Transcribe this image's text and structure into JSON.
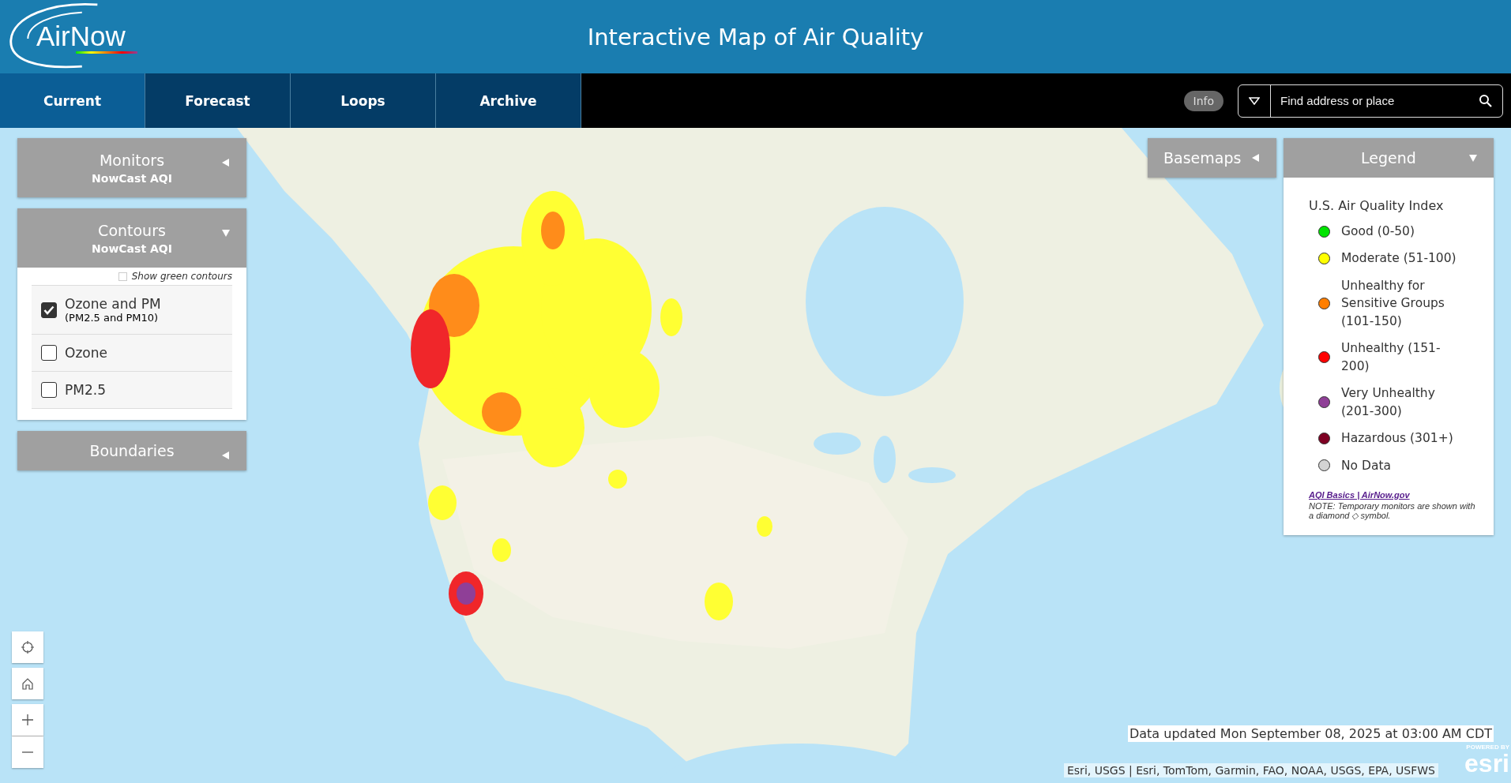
{
  "header": {
    "logo": "AirNow",
    "title": "Interactive Map of Air Quality"
  },
  "tabs": [
    {
      "label": "Current",
      "selected": true
    },
    {
      "label": "Forecast",
      "selected": false
    },
    {
      "label": "Loops",
      "selected": false
    },
    {
      "label": "Archive",
      "selected": false
    }
  ],
  "info_button": "Info",
  "search": {
    "placeholder": "Find address or place"
  },
  "left_panels": [
    {
      "title": "Monitors",
      "subtitle": "NowCast AQI",
      "expanded": false
    },
    {
      "title": "Contours",
      "subtitle": "NowCast AQI",
      "expanded": true,
      "show_green": {
        "label": "Show green contours",
        "checked": false
      },
      "options": [
        {
          "label": "Ozone and PM",
          "sublabel": "(PM2.5 and PM10)",
          "checked": true
        },
        {
          "label": "Ozone",
          "checked": false
        },
        {
          "label": "PM2.5",
          "checked": false
        }
      ]
    },
    {
      "title": "Boundaries",
      "expanded": false
    }
  ],
  "basemaps": {
    "title": "Basemaps",
    "expanded": false
  },
  "legend": {
    "title": "Legend",
    "expanded": true,
    "heading": "U.S. Air Quality Index",
    "items": [
      {
        "label": "Good (0-50)",
        "color": "#00e400"
      },
      {
        "label": "Moderate (51-100)",
        "color": "#ffff00"
      },
      {
        "label": "Unhealthy for Sensitive Groups (101-150)",
        "color": "#ff7e00"
      },
      {
        "label": "Unhealthy (151-200)",
        "color": "#ff0000"
      },
      {
        "label": "Very Unhealthy (201-300)",
        "color": "#8f3f97"
      },
      {
        "label": "Hazardous (301+)",
        "color": "#7e0023"
      },
      {
        "label": "No Data",
        "color": "#d3d3d3"
      }
    ],
    "link": "AQI Basics | AirNow.gov",
    "note": "NOTE: Temporary monitors are shown with a diamond ◇ symbol."
  },
  "data_updated": "Data updated Mon September 08, 2025 at 03:00 AM CDT",
  "attribution": "Esri, USGS | Esri, TomTom, Garmin, FAO, NOAA, USGS, EPA, USFWS",
  "esri": {
    "powered_by": "POWERED BY",
    "logo": "esri"
  }
}
